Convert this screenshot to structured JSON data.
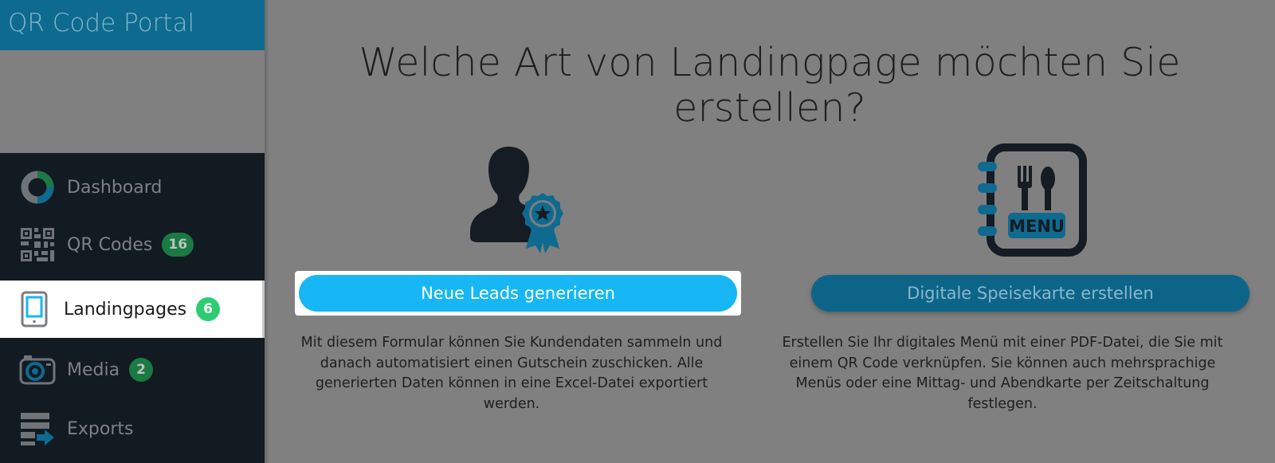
{
  "brand": {
    "title": "QR Code Portal"
  },
  "nav": {
    "items": [
      {
        "label": "Dashboard",
        "badge": ""
      },
      {
        "label": "QR Codes",
        "badge": "16"
      },
      {
        "label": "Landingpages",
        "badge": "6"
      },
      {
        "label": "Media",
        "badge": "2"
      },
      {
        "label": "Exports",
        "badge": ""
      }
    ]
  },
  "main": {
    "headline": "Welche Art von Landingpage möchten Sie erstellen?",
    "cards": [
      {
        "button": "Neue Leads generieren",
        "description": "Mit diesem Formular können Sie Kundendaten sammeln und danach automatisiert einen Gutschein zuschicken. Alle generierten Daten können in eine Excel-Datei exportiert werden."
      },
      {
        "icon_text": "MENU",
        "button": "Digitale Speisekarte erstellen",
        "description": "Erstellen Sie Ihr digitales Menü mit einer PDF-Datei, die Sie mit einem QR Code verknüpfen. Sie können auch mehrsprachige Menüs oder eine Mittag- und Abendkarte per Zeitschaltung festlegen."
      }
    ]
  },
  "colors": {
    "brand": "#0f6a8f",
    "accent": "#16b7f4",
    "badge_active": "#2ecc71",
    "nav_bg": "#121a22"
  },
  "icons": {
    "dashboard": "donut-chart-icon",
    "qr": "qr-code-icon",
    "landing": "smartphone-icon",
    "media": "camera-icon",
    "exports": "export-icon",
    "leads": "user-award-icon",
    "menu": "menu-book-icon"
  }
}
